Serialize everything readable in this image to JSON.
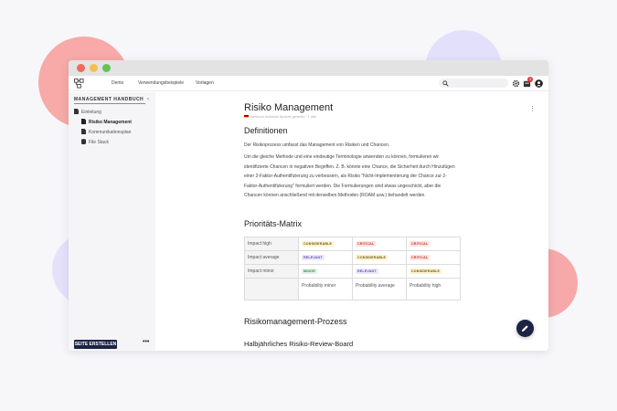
{
  "app": {
    "nav": [
      "Demo",
      "Verwendungsbeispiele",
      "Vorlagen"
    ],
    "notification_count": "3"
  },
  "sidebar": {
    "title": "MANAGEMENT HANDBUCH",
    "items": [
      {
        "label": "Einleitung",
        "icon": "document-icon"
      },
      {
        "label": "Risiko Management",
        "icon": "document-icon",
        "active": true
      },
      {
        "label": "Kommunikationsplan",
        "icon": "document-icon"
      },
      {
        "label": "File Stack",
        "icon": "stack-icon"
      }
    ],
    "create_button": "SEITE ERSTELLEN",
    "more": "•••"
  },
  "page": {
    "title": "Risiko Management",
    "meta": "Version in einfacher Sprache generiert · 1 Jahr",
    "sections": {
      "definitionen": "Definitionen",
      "para1": "Der Risikoprozess umfasst das Management von Risiken und Chancen.",
      "para2": "Um die gleiche Methode und eine eindeutige Terminologie anwenden zu können, formulieren wir identifizierte Chancen in negativen Begriffen. Z. B. könnte eine Chance, die Sicherheit durch Hinzufügen einer 2-Faktor-Authentifizierung zu verbessern, als Risiko \"Nicht-Implementierung der Chance zur 2-Faktor-Authentifizierung\" formuliert werden. Die Formulierungen sind etwas ungeschickt, aber die Chancen können anschließend mit denselben Methoden (ROAM usw.) behandelt werden.",
      "matrix": "Prioritäts-Matrix",
      "prozess": "Risikomanagement-Prozess",
      "board": "Halbjährliches Risiko-Review-Board"
    },
    "matrix": {
      "rows": [
        {
          "label": "Impact high",
          "cells": [
            "CONSIDERABLE",
            "CRITICAL",
            "CRITICAL"
          ]
        },
        {
          "label": "Impact average",
          "cells": [
            "RELEVANT",
            "CONSIDERABLE",
            "CRITICAL"
          ]
        },
        {
          "label": "Impact minor",
          "cells": [
            "MINOR",
            "RELEVANT",
            "CONSIDERABLE"
          ]
        }
      ],
      "columns": [
        "Probability minor",
        "Probability average",
        "Probability high"
      ]
    }
  },
  "colors": {
    "accent": "#1c2445",
    "considerable": "#fdf3cf",
    "critical": "#fde4e2",
    "relevant": "#ece8fb",
    "minor": "#e2f4e6"
  }
}
